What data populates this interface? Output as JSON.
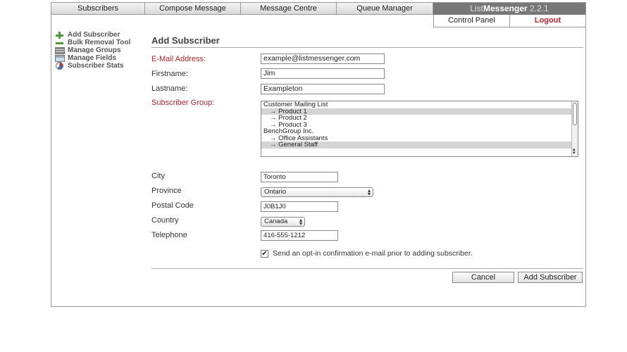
{
  "tabs": [
    {
      "label": "Subscribers"
    },
    {
      "label": "Compose Message"
    },
    {
      "label": "Message Centre"
    },
    {
      "label": "Queue Manager"
    }
  ],
  "brand": {
    "prefix": "List",
    "bold": "Messenger",
    "version": "2.2.1"
  },
  "control": {
    "panel_label": "Control Panel",
    "logout_label": "Logout"
  },
  "sidebar": {
    "items": [
      {
        "label": "Add Subscriber",
        "icon": "plus-icon"
      },
      {
        "label": "Bulk Removal Tool",
        "icon": "minus-icon"
      },
      {
        "label": "Manage Groups",
        "icon": "groups-icon"
      },
      {
        "label": "Manage Fields",
        "icon": "fields-icon"
      },
      {
        "label": "Subscriber Stats",
        "icon": "stats-icon"
      }
    ]
  },
  "main": {
    "title": "Add Subscriber",
    "email": {
      "label": "E-Mail Address:",
      "value": "example@listmessenger.com"
    },
    "firstname": {
      "label": "Firstname:",
      "value": "Jim"
    },
    "lastname": {
      "label": "Lastname:",
      "value": "Exampleton"
    },
    "group": {
      "label": "Subscriber Group:",
      "options": [
        {
          "label": "Customer Mailing List",
          "selected": false,
          "child": false
        },
        {
          "label": "→ Product 1",
          "selected": true,
          "child": true
        },
        {
          "label": "→ Product 2",
          "selected": false,
          "child": true
        },
        {
          "label": "→ Product 3",
          "selected": false,
          "child": true
        },
        {
          "label": "BenchGroup Inc.",
          "selected": false,
          "child": false
        },
        {
          "label": "→ Office Assistants",
          "selected": false,
          "child": true
        },
        {
          "label": "→ General Staff",
          "selected": true,
          "child": true
        }
      ]
    },
    "city": {
      "label": "City",
      "value": "Toronto"
    },
    "province": {
      "label": "Province",
      "value": "Ontario"
    },
    "postal": {
      "label": "Postal Code",
      "value": "J0B1J0"
    },
    "country": {
      "label": "Country",
      "value": "Canada"
    },
    "telephone": {
      "label": "Telephone",
      "value": "416-555-1212"
    },
    "optin": {
      "checked": true,
      "label": "Send an opt-in confirmation e-mail prior to adding subscriber."
    },
    "cancel_label": "Cancel",
    "submit_label": "Add Subscriber"
  },
  "colors": {
    "required_label": "#b3232b",
    "logout": "#b3232b",
    "brand_bg": "#777777",
    "sidebar_icon": "#4a9a3a"
  }
}
